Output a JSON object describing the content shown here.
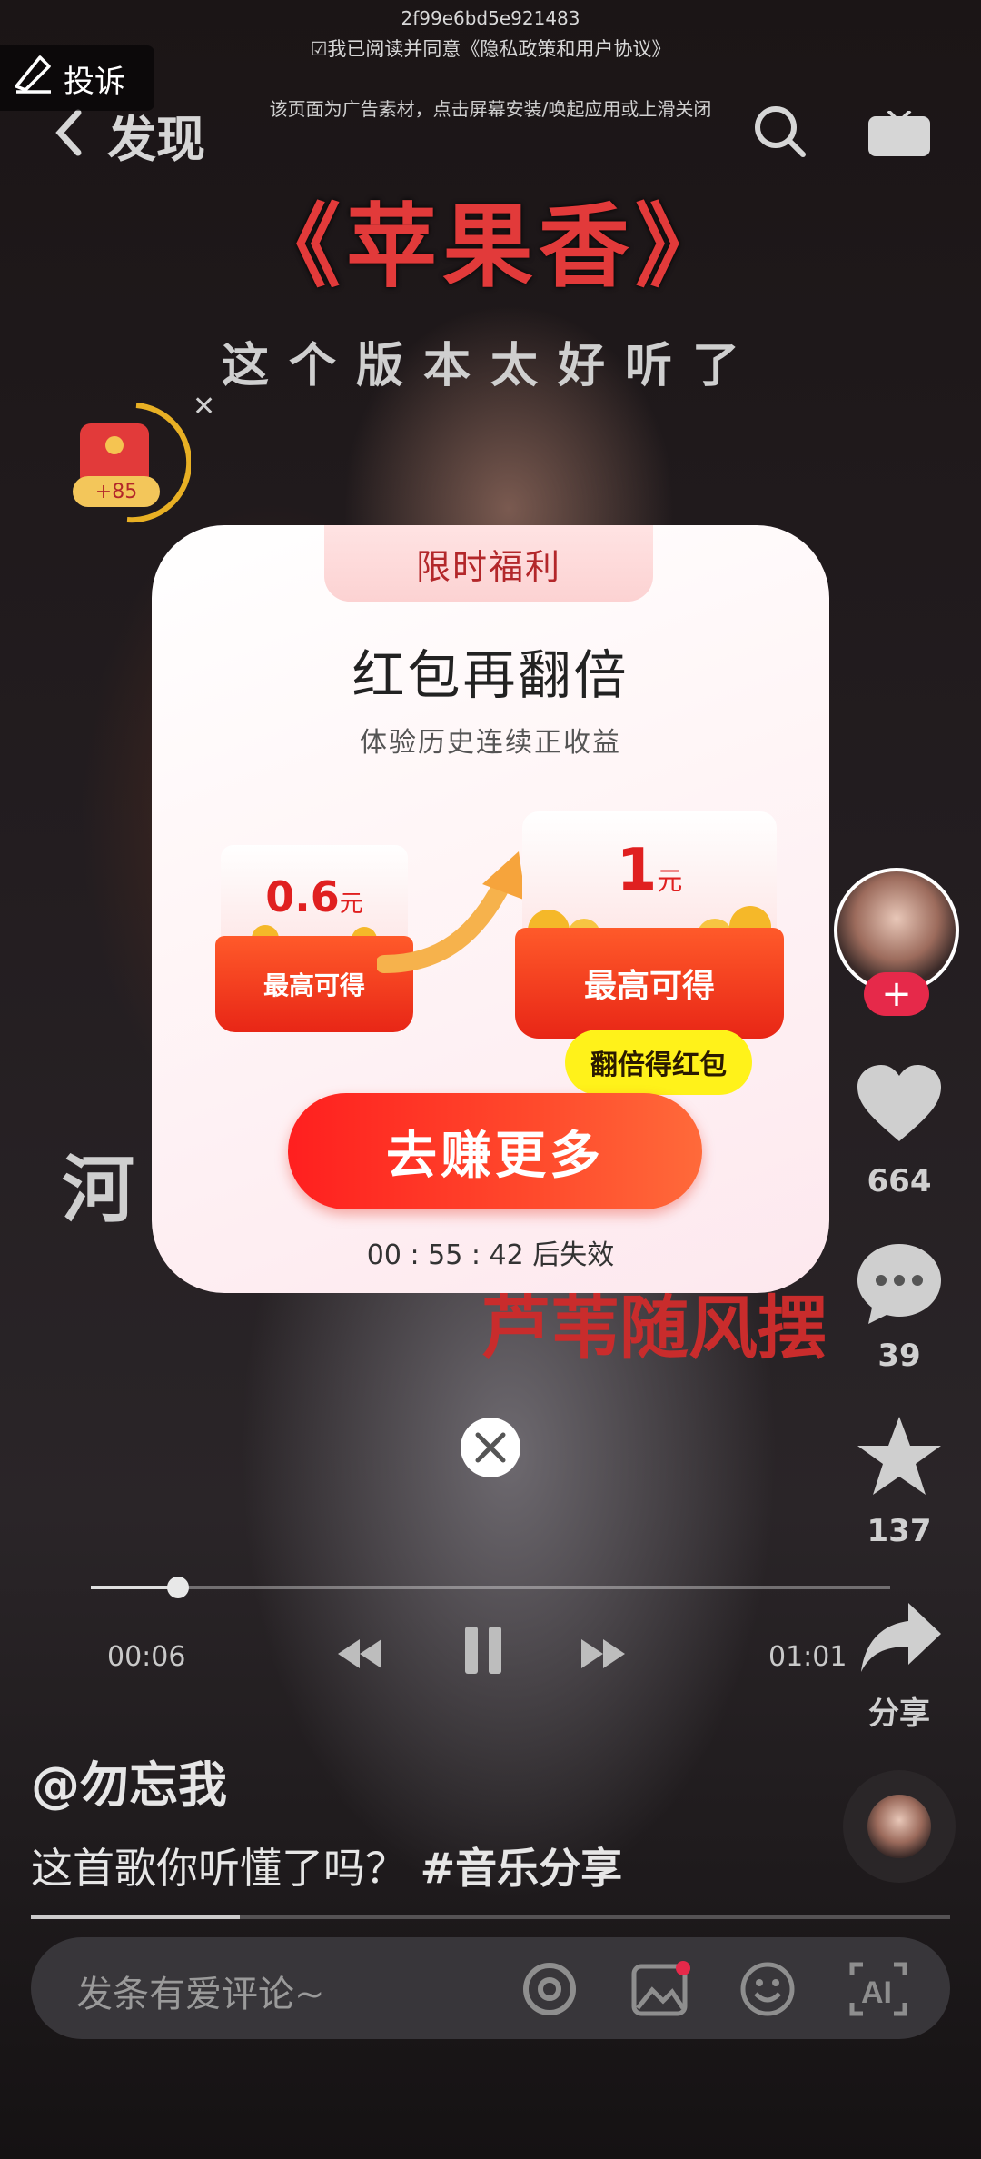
{
  "ad": {
    "id_text": "2f99e6bd5e921483",
    "agreement_text": "☑我已阅读并同意《隐私政策和用户协议》",
    "note": "该页面为广告素材，点击屏幕安装/唤起应用或上滑关闭",
    "report_label": "投诉"
  },
  "header": {
    "title": "发现"
  },
  "video": {
    "song_title": "《苹果香》",
    "song_subtitle": "这个版本太好听了",
    "lyric_left": "河",
    "lyric_red": "芦苇随风摆",
    "elapsed": "00:06",
    "duration": "01:01",
    "progress": 0.1
  },
  "redpack_widget": {
    "bonus": "+85"
  },
  "rail": {
    "likes": "664",
    "comments": "39",
    "favorites": "137",
    "share_label": "分享",
    "follow_symbol": "+"
  },
  "post": {
    "author": "@勿忘我",
    "description": "这首歌你听懂了吗？",
    "hashtag": "#音乐分享"
  },
  "comment": {
    "placeholder": "发条有爱评论~"
  },
  "modal": {
    "tab": "限时福利",
    "title": "红包再翻倍",
    "subtitle": "体验历史连续正收益",
    "small_amount": "0.6",
    "big_amount": "1",
    "unit": "元",
    "envelope_label": "最高可得",
    "bubble": "翻倍得红包",
    "cta": "去赚更多",
    "countdown": "00 : 55 : 42 后失效"
  },
  "colors": {
    "accent_red": "#ff2a1f",
    "bubble_yellow": "#fff21a",
    "follow_pink": "#e6294a"
  }
}
